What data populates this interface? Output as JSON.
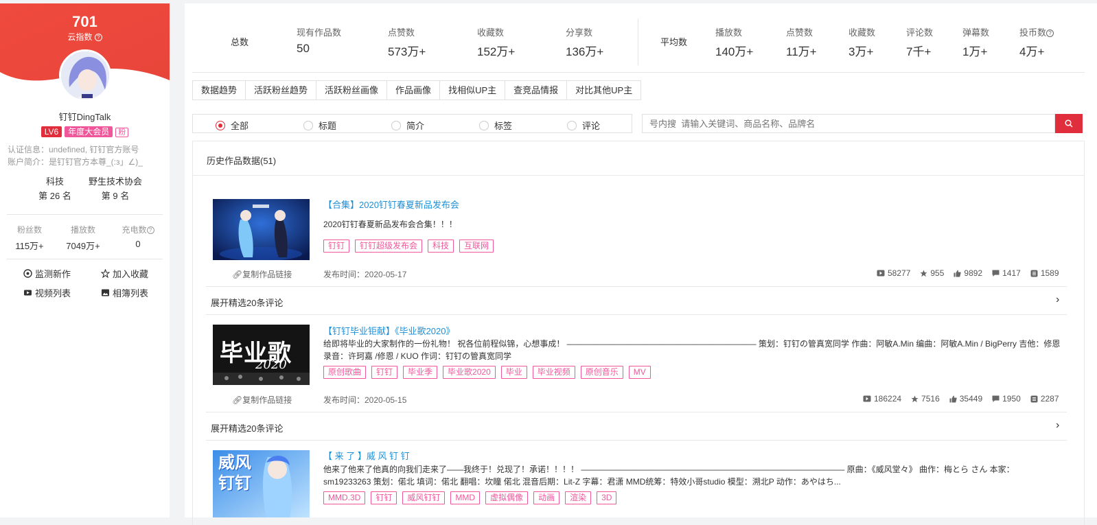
{
  "sidebar": {
    "score": "701",
    "score_label": "云指数",
    "name": "钉钉DingTalk",
    "badges": {
      "level": "LV6",
      "vip": "年度大会员",
      "fan": "粉"
    },
    "auth_info": "认证信息：undefined, 钉钉官方账号",
    "bio": "账户简介：是钉钉官方本尊_(:з」∠)_",
    "rankings": [
      {
        "category": "科技",
        "rank": "第 26 名"
      },
      {
        "category": "野生技术协会",
        "rank": "第 9 名"
      }
    ],
    "stats": [
      {
        "label": "粉丝数",
        "value": "115万+"
      },
      {
        "label": "播放数",
        "value": "7049万+"
      },
      {
        "label": "充电数",
        "value": "0"
      }
    ],
    "actions": [
      "监测新作",
      "加入收藏",
      "视频列表",
      "相簿列表"
    ]
  },
  "summary": {
    "total_label": "总数",
    "total": [
      {
        "label": "现有作品数",
        "value": "50"
      },
      {
        "label": "点赞数",
        "value": "573万+"
      },
      {
        "label": "收藏数",
        "value": "152万+"
      },
      {
        "label": "分享数",
        "value": "136万+"
      }
    ],
    "avg_label": "平均数",
    "average": [
      {
        "label": "播放数",
        "value": "140万+"
      },
      {
        "label": "点赞数",
        "value": "11万+"
      },
      {
        "label": "收藏数",
        "value": "3万+"
      },
      {
        "label": "评论数",
        "value": "7千+"
      },
      {
        "label": "弹幕数",
        "value": "1万+"
      },
      {
        "label": "投币数",
        "value": "4万+"
      }
    ]
  },
  "tabs": [
    "数据趋势",
    "活跃粉丝趋势",
    "活跃粉丝画像",
    "作品画像",
    "找相似UP主",
    "查竞品情报",
    "对比其他UP主"
  ],
  "filters": {
    "options": [
      "全部",
      "标题",
      "简介",
      "标签",
      "评论"
    ],
    "selected": "全部"
  },
  "search": {
    "placeholder": "号内搜  请输入关键词、商品名称、品牌名"
  },
  "history": {
    "title": "历史作品数据(51)",
    "copy_label": "复制作品链接",
    "expand_label": "展开精选20条评论",
    "videos": [
      {
        "title": "【合集】2020钉钉春夏新品发布会",
        "desc": "2020钉钉春夏新品发布会合集！！！",
        "tags": [
          "钉钉",
          "钉钉超级发布会",
          "科技",
          "互联网"
        ],
        "publish": "发布时间：2020-05-17",
        "plays": "58277",
        "favorites": "955",
        "likes": "9892",
        "comments": "1417",
        "coins": "1589"
      },
      {
        "title": "【钉钉毕业钜献】《毕业歌2020》",
        "desc": "给即将毕业的大家制作的一份礼物！ 祝各位前程似锦，心想事成！ ——————————————————————— 策划：钉钉の管真宽同学 作曲：阿敏A.Min 编曲：阿敏A.Min / BigPerry 吉他：修恩 录音：许珂嘉 /修恩 / KUO 作词：钉钉の管真宽同学",
        "thumb_text": "毕业歌",
        "thumb_year": "2020",
        "tags": [
          "原创歌曲",
          "钉钉",
          "毕业季",
          "毕业歌2020",
          "毕业",
          "毕业视频",
          "原创音乐",
          "MV"
        ],
        "publish": "发布时间：2020-05-15",
        "plays": "186224",
        "favorites": "7516",
        "likes": "35449",
        "comments": "1950",
        "coins": "2287"
      },
      {
        "title": "【 来 了 】威 风 钉 钉",
        "desc": "他来了他来了他真的向我们走来了——我终于！兑现了！承诺！！！！ ———————————————————————————————— 原曲：《威风堂々》 曲作：梅とら さん 本家：sm19233263 策划：偌北 填词：偌北 翻唱：坎瞳 偌北 混音后期：Lit-Z 字幕：君潇 MMD统筹：特效小哥studio 模型：溯北P 动作：あやはち...",
        "thumb_text": "威风\n钉钉",
        "tags": [
          "MMD.3D",
          "钉钉",
          "威风钉钉",
          "MMD",
          "虚拟偶像",
          "动画",
          "渲染",
          "3D"
        ]
      }
    ]
  },
  "colors": {
    "brand_red": "#e02e3c",
    "tag_pink": "#f0579a",
    "link_blue": "#1e90d6"
  }
}
